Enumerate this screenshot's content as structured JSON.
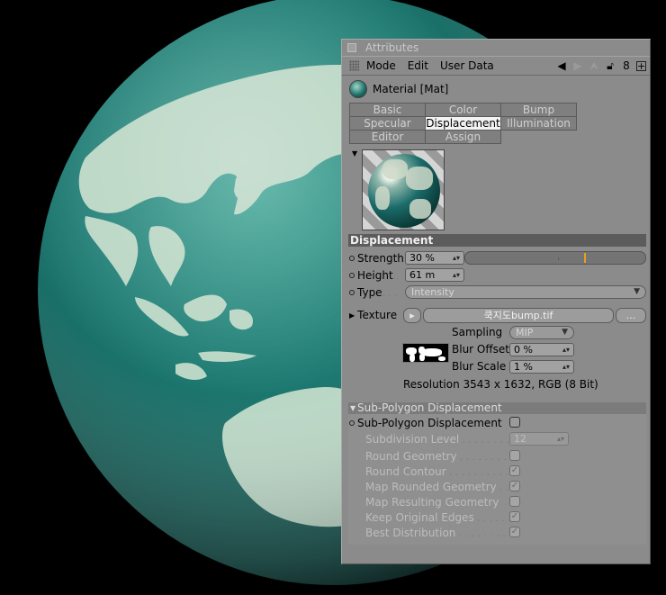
{
  "panel": {
    "title": "Attributes",
    "menu": [
      "Mode",
      "Edit",
      "User Data"
    ],
    "toolbar_icons": [
      "arrow-left-icon",
      "arrow-right-icon",
      "arrow-up-icon",
      "lock-icon",
      "link-icon",
      "new-panel-icon"
    ],
    "object_label": "Material [Mat]",
    "tabs": [
      [
        "Basic",
        "Color",
        "Bump"
      ],
      [
        "Specular",
        "Displacement",
        "Illumination"
      ],
      [
        "Editor",
        "Assign"
      ]
    ],
    "active_tab": "Displacement"
  },
  "displacement": {
    "heading": "Displacement",
    "strength_label": "Strength",
    "strength_value": "30 %",
    "strength_fraction": 0.66,
    "height_label": "Height",
    "height_value": "61 m",
    "type_label": "Type",
    "type_value": "Intensity",
    "texture_label": "Texture",
    "texture_file": "쿡지도bump.tif",
    "texture_more": "...",
    "sampling_label": "Sampling",
    "sampling_value": "MIP",
    "blur_offset_label": "Blur Offset",
    "blur_offset_value": "0 %",
    "blur_scale_label": "Blur Scale",
    "blur_scale_value": "1 %",
    "resolution": "Resolution 3543 x 1632, RGB (8 Bit)"
  },
  "subpoly": {
    "heading": "Sub-Polygon Displacement",
    "enable_label": "Sub-Polygon Displacement",
    "enable_checked": false,
    "subdivision_label": "Subdivision Level",
    "subdivision_value": "12",
    "options": [
      {
        "label": "Round Geometry",
        "checked": false
      },
      {
        "label": "Round Contour",
        "checked": true
      },
      {
        "label": "Map Rounded Geometry",
        "checked": true
      },
      {
        "label": "Map Resulting Geometry",
        "checked": false
      },
      {
        "label": "Keep Original Edges",
        "checked": true
      },
      {
        "label": "Best Distribution",
        "checked": true
      }
    ]
  },
  "colors": {
    "globe_ocean": "#1d7a72",
    "globe_land": "#b9d6c4",
    "panel_bg": "#8b8b8b",
    "section_header": "#5c5c5c",
    "slider_marker": "#e3a21a"
  }
}
